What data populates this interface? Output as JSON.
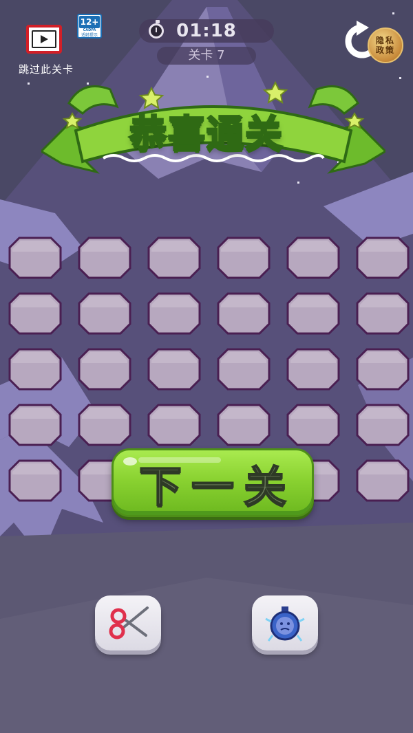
{
  "header": {
    "skip_label": "跳过此关卡",
    "age_rating": "12+",
    "age_org": "CADPA",
    "age_tip": "适龄提示",
    "timer": "01:18",
    "level": "关卡 7",
    "privacy_label": "隐私政策"
  },
  "banner": {
    "title": "恭喜通关"
  },
  "grid": {
    "rows": 5,
    "cols": 6
  },
  "actions": {
    "next_label": "下一关"
  },
  "tools": [
    {
      "name": "scissors",
      "icon": "scissors-icon"
    },
    {
      "name": "freeze",
      "icon": "frozen-clock-icon"
    }
  ],
  "colors": {
    "tile_fill": "#b7a8bf",
    "tile_border": "#4a1f52",
    "next_button": "#8ad231",
    "banner_green": "#8ccf3a"
  }
}
